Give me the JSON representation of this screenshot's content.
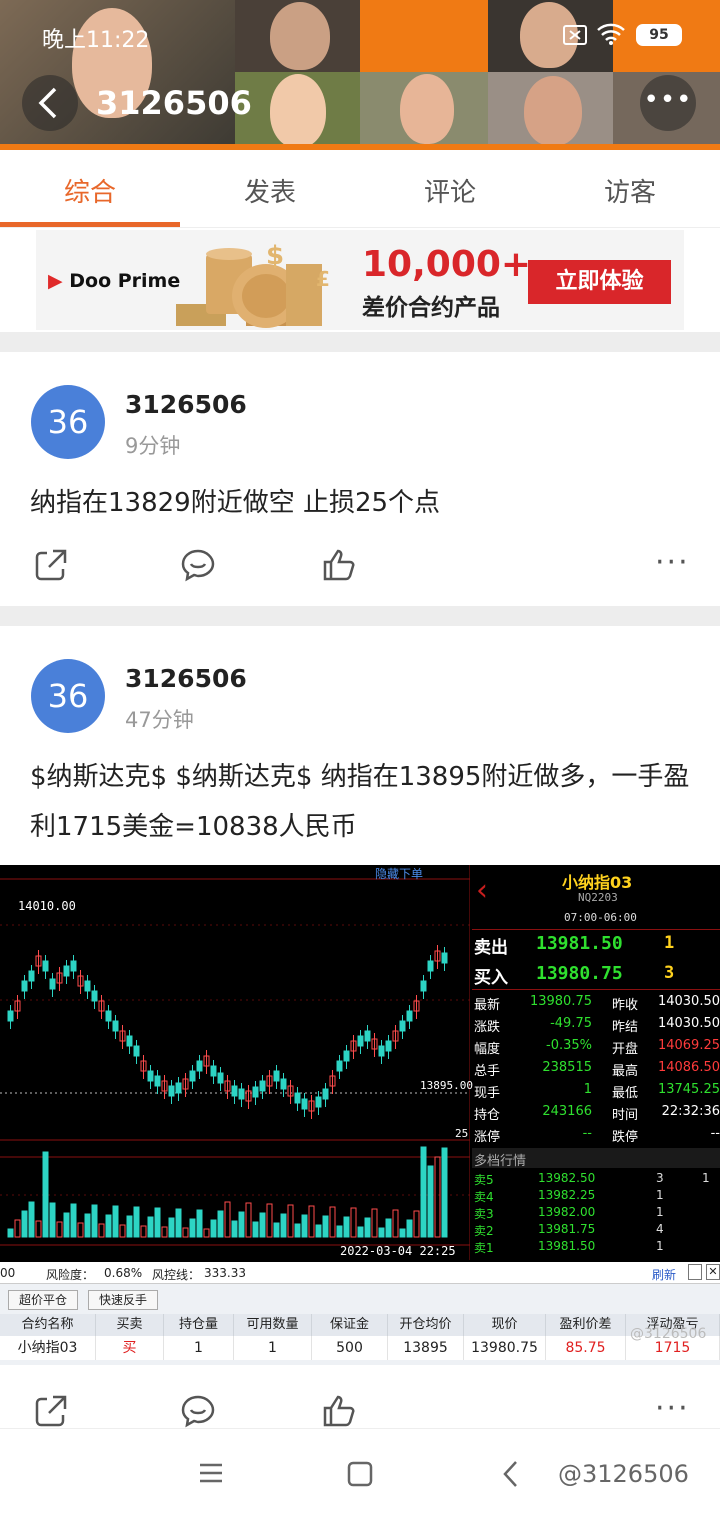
{
  "status_bar": {
    "time": "晚上11:22",
    "battery": "95"
  },
  "header": {
    "title": "3126506"
  },
  "tabs": [
    {
      "label": "综合"
    },
    {
      "label": "发表"
    },
    {
      "label": "评论"
    },
    {
      "label": "访客"
    }
  ],
  "ad": {
    "brand": "Doo Prime",
    "amount": "10,000+",
    "subtitle": "差价合约产品",
    "cta": "立即体验"
  },
  "posts": [
    {
      "avatar": "36",
      "user": "3126506",
      "time": "9分钟",
      "text": "纳指在13829附近做空 止损25个点"
    },
    {
      "avatar": "36",
      "user": "3126506",
      "time": "47分钟",
      "text": "$纳斯达克$ $纳斯达克$ 纳指在13895附近做多，一手盈利1715美金=10838人民币"
    }
  ],
  "screenshot": {
    "hide_order": "隐藏下单",
    "high_label": "14010.00",
    "price_label": "13895.00",
    "small_label": "25",
    "date": "2022-03-04 22:25",
    "instrument": "小纳指03",
    "code": "NQ2203",
    "hours": "07:00-06:00",
    "sell": {
      "label": "卖出",
      "price": "13981.50",
      "qty": "1"
    },
    "buy": {
      "label": "买入",
      "price": "13980.75",
      "qty": "3"
    },
    "quotes": [
      {
        "k1": "最新",
        "v1": "13980.75",
        "k2": "昨收",
        "v2": "14030.50"
      },
      {
        "k1": "涨跌",
        "v1": "-49.75",
        "k2": "昨结",
        "v2": "14030.50"
      },
      {
        "k1": "幅度",
        "v1": "-0.35%",
        "k2": "开盘",
        "v2": "14069.25"
      },
      {
        "k1": "总手",
        "v1": "238515",
        "k2": "最高",
        "v2": "14086.50"
      },
      {
        "k1": "现手",
        "v1": "1",
        "k2": "最低",
        "v2": "13745.25"
      },
      {
        "k1": "持仓",
        "v1": "243166",
        "k2": "时间",
        "v2": "22:32:36"
      },
      {
        "k1": "涨停",
        "v1": "--",
        "k2": "跌停",
        "v2": "--"
      }
    ],
    "depth_title": "多档行情",
    "depth": [
      {
        "k": "卖5",
        "p": "13982.50",
        "a": "3",
        "b": "1"
      },
      {
        "k": "卖4",
        "p": "13982.25",
        "a": "1",
        "b": ""
      },
      {
        "k": "卖3",
        "p": "13982.00",
        "a": "1",
        "b": ""
      },
      {
        "k": "卖2",
        "p": "13981.75",
        "a": "4",
        "b": ""
      },
      {
        "k": "卖1",
        "p": "13981.50",
        "a": "1",
        "b": ""
      }
    ],
    "risk": {
      "left": "00",
      "risk_label": "风险度：",
      "risk": "0.68%",
      "line_label": "风控线：",
      "line": "333.33",
      "refresh": "刷新"
    },
    "buttons": [
      "超价平仓",
      "快速反手"
    ],
    "table_headers": [
      "合约名称",
      "买卖",
      "持仓量",
      "可用数量",
      "保证金",
      "开仓均价",
      "现价",
      "盈利价差",
      "浮动盈亏"
    ],
    "table_row": [
      "小纳指03",
      "买",
      "1",
      "1",
      "500",
      "13895",
      "13980.75",
      "85.75",
      "1715"
    ],
    "watermark": "@3126506"
  },
  "watermark": "@3126506"
}
